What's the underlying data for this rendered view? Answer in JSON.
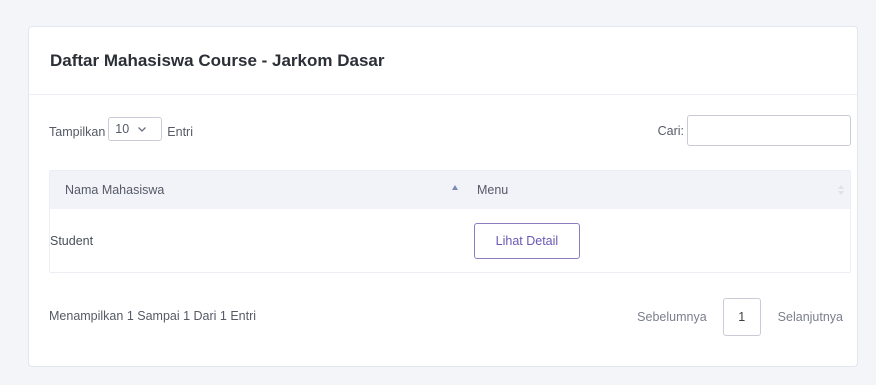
{
  "card": {
    "title": "Daftar Mahasiswa Course - Jarkom Dasar"
  },
  "length": {
    "prefix": "Tampilkan",
    "selected": "10",
    "suffix": "Entri"
  },
  "search": {
    "label": "Cari:",
    "value": ""
  },
  "table": {
    "columns": [
      "Nama Mahasiswa",
      "Menu"
    ],
    "rows": [
      {
        "name": "Student",
        "action": "Lihat Detail"
      }
    ]
  },
  "footer": {
    "info": "Menampilkan 1 Sampai 1 Dari 1 Entri",
    "prev": "Sebelumnya",
    "page": "1",
    "next": "Selanjutnya"
  },
  "colors": {
    "accent": "#6b58b5",
    "header_bg": "#f1f3f9"
  },
  "icons": {
    "select_chevron": "chevron-down-icon",
    "sort_asc": "sort-asc-icon",
    "sort_both": "sort-both-icon"
  }
}
